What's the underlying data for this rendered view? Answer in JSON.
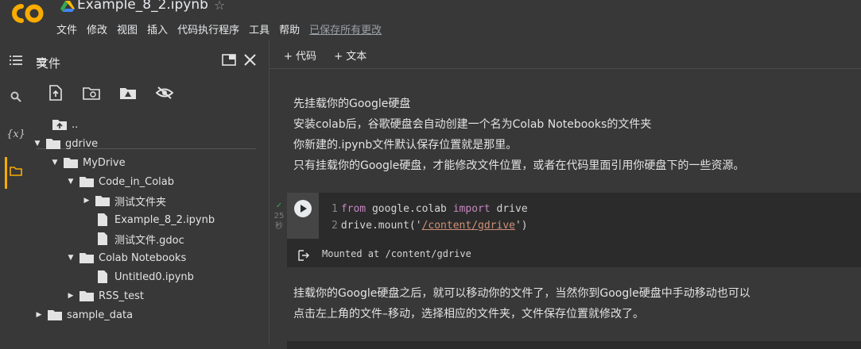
{
  "header": {
    "title": "Example_8_2.ipynb",
    "menu": [
      "文件",
      "修改",
      "视图",
      "插入",
      "代码执行程序",
      "工具",
      "帮助"
    ],
    "saved_label": "已保存所有更改"
  },
  "sidebar": {
    "title": "文件",
    "tree": [
      {
        "label": "..",
        "type": "parent-folder"
      },
      {
        "label": "gdrive",
        "type": "folder",
        "expanded": true
      },
      {
        "label": "MyDrive",
        "type": "folder",
        "expanded": true
      },
      {
        "label": "Code_in_Colab",
        "type": "folder",
        "expanded": true
      },
      {
        "label": "测试文件夹",
        "type": "folder",
        "expanded": false
      },
      {
        "label": "Example_8_2.ipynb",
        "type": "file"
      },
      {
        "label": "测试文件.gdoc",
        "type": "file"
      },
      {
        "label": "Colab Notebooks",
        "type": "folder",
        "expanded": true
      },
      {
        "label": "Untitled0.ipynb",
        "type": "file"
      },
      {
        "label": "RSS_test",
        "type": "folder",
        "expanded": false
      },
      {
        "label": "sample_data",
        "type": "folder",
        "expanded": false
      }
    ]
  },
  "toolbar": {
    "add_code": "+ 代码",
    "add_text": "+ 文本"
  },
  "markdown1": {
    "lines": [
      "先挂载你的Google硬盘",
      "安装colab后，谷歌硬盘会自动创建一个名为Colab Notebooks的文件夹",
      "你新建的.ipynb文件默认保存位置就是那里。",
      "只有挂载你的Google硬盘，才能修改文件位置，或者在代码里面引用你硬盘下的一些资源。"
    ]
  },
  "code_cell": {
    "status_check": "✓",
    "status_time": "25",
    "status_unit": "秒",
    "line1": {
      "num": "1",
      "kw1": "from",
      "mod": "google.colab",
      "kw2": "import",
      "name": "drive"
    },
    "line2": {
      "num": "2",
      "prefix": "drive.mount('",
      "path": "/content/gdrive",
      "suffix": "')"
    },
    "output": "Mounted at /content/gdrive"
  },
  "markdown2": {
    "lines": [
      "挂载你的Google硬盘之后，就可以移动你的文件了，当然你到Google硬盘中手动移动也可以",
      "点击左上角的文件–移动，选择相应的文件夹，文件保存位置就修改了。"
    ]
  },
  "colors": {
    "background": "#383838",
    "code_bg": "#2b2b2b",
    "accent": "#f9ab00",
    "keyword": "#c586c0",
    "string": "#ce9178"
  }
}
